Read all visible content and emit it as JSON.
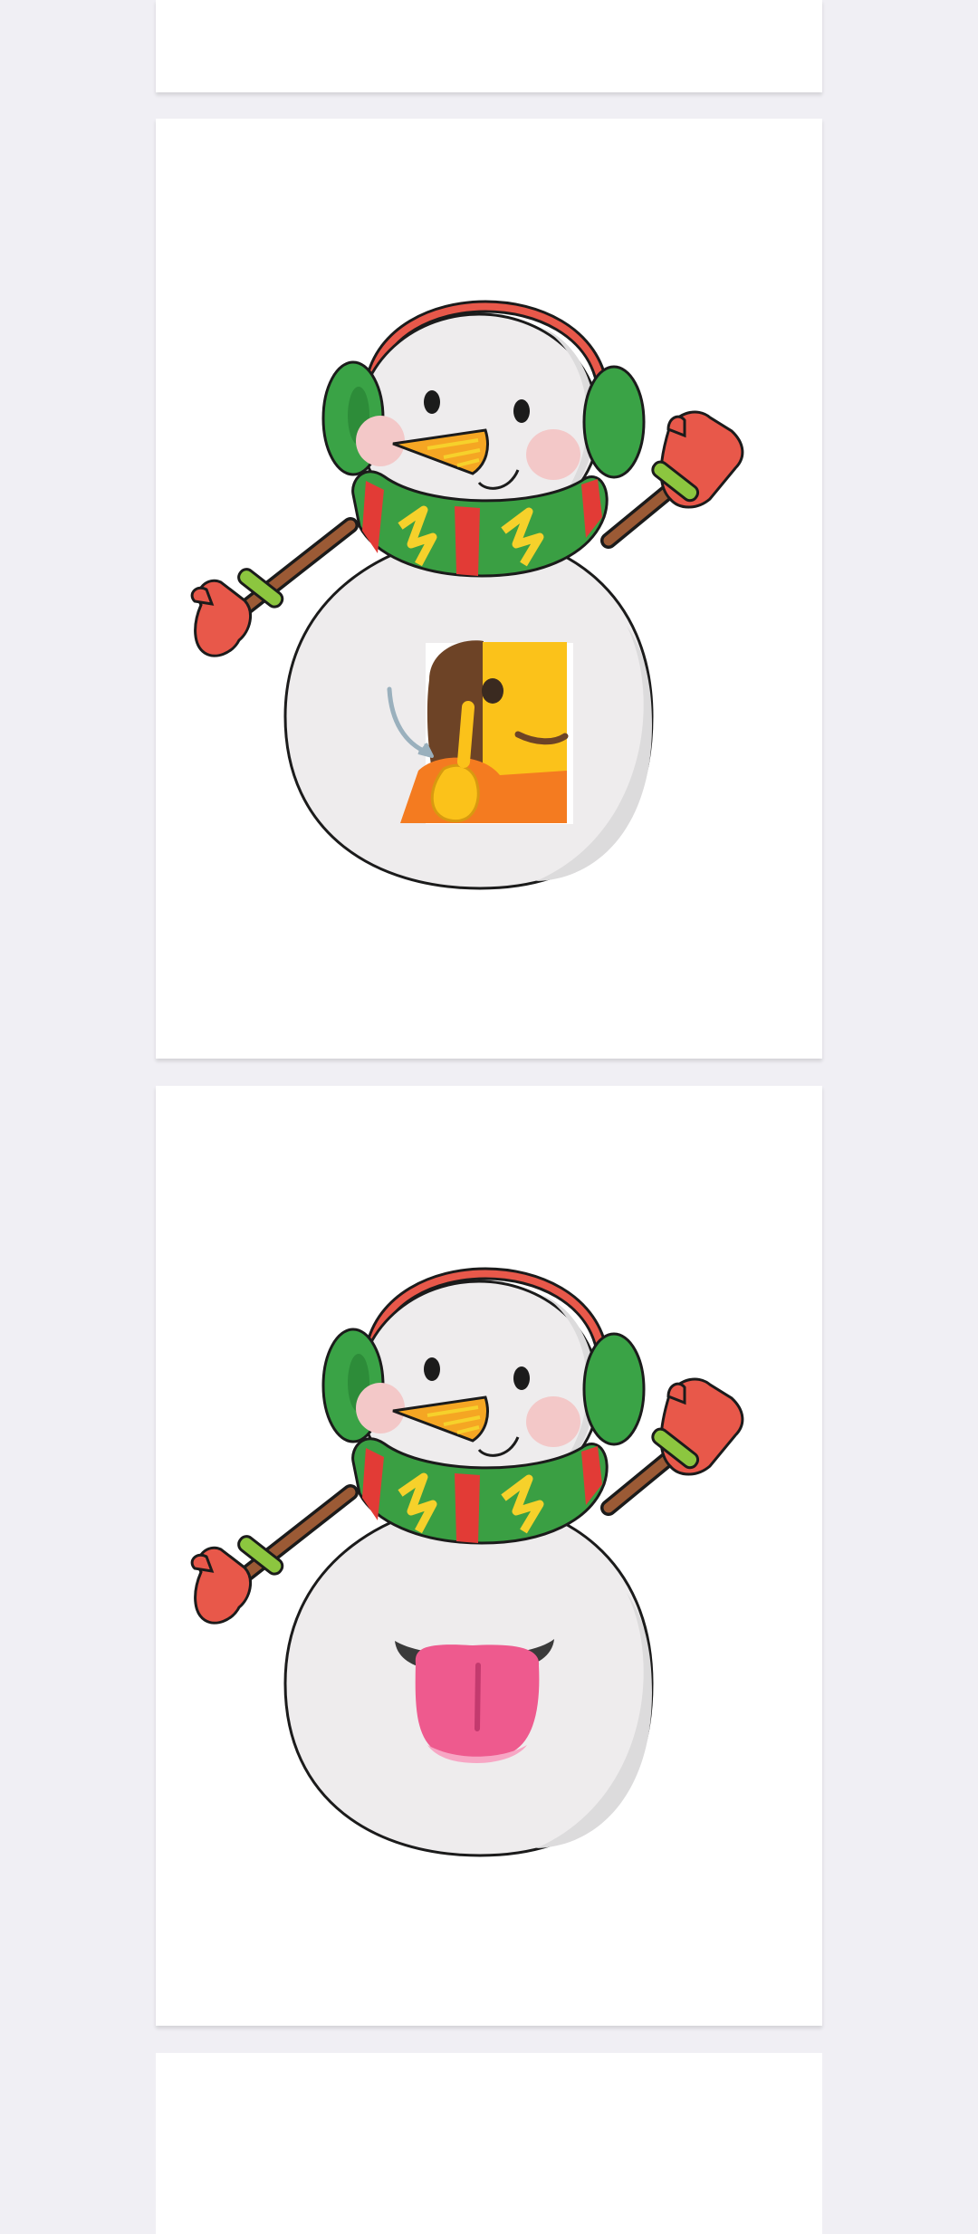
{
  "screen": {
    "background_color": "#f0eff4",
    "card_color": "#ffffff"
  },
  "cards": [
    {
      "id": "partial-top",
      "content": "empty"
    },
    {
      "id": "snowman-deaf-person",
      "sticker_icon": "snowman-icon",
      "chest_emoji_icon": "deaf-person-emoji-icon"
    },
    {
      "id": "snowman-tongue",
      "sticker_icon": "snowman-icon",
      "chest_emoji_icon": "tongue-emoji-icon"
    },
    {
      "id": "partial-bottom",
      "content": "empty"
    }
  ],
  "colors": {
    "snow_body": "#eeeced",
    "snow_shade": "#dcdbdc",
    "outline": "#1b1b1b",
    "earmuff_band": "#e8584a",
    "earmuff_pad": "#3aa346",
    "mitten": "#e8584a",
    "mitten_cuff": "#8cc63f",
    "arm": "#9b5a35",
    "scarf_red": "#e23b36",
    "scarf_green": "#3a9f43",
    "scarf_zigzag": "#f6d12b",
    "nose": "#f5a623",
    "cheek": "#f3c8c8",
    "emoji_skin": "#fbc21a",
    "emoji_hair": "#6d4326",
    "emoji_shirt": "#f47b20",
    "tongue": "#ee5a8e",
    "mouth_dark": "#3a3a3a"
  }
}
